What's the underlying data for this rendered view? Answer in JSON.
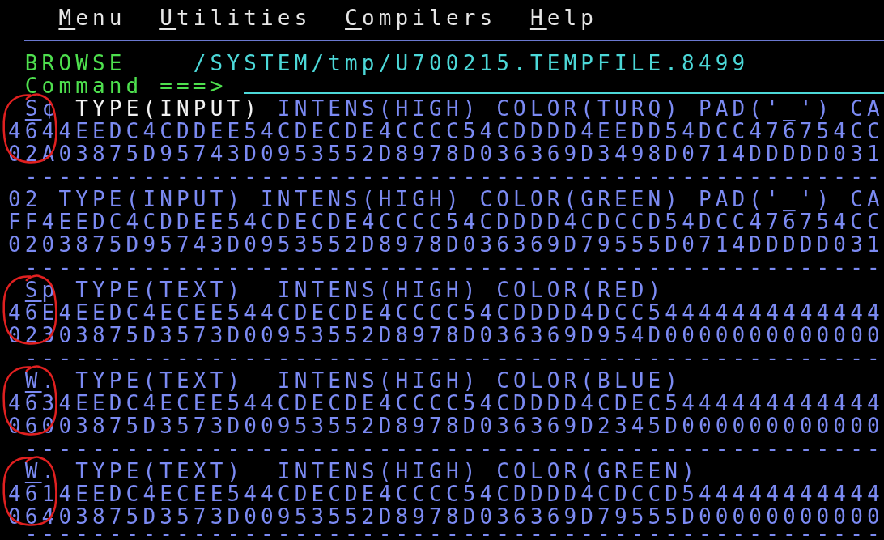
{
  "menu_bar": {
    "items": [
      {
        "mnemonic": "M",
        "rest": "enu"
      },
      {
        "mnemonic": "U",
        "rest": "tilities"
      },
      {
        "mnemonic": "C",
        "rest": "ompilers"
      },
      {
        "mnemonic": "H",
        "rest": "elp"
      }
    ]
  },
  "browse": {
    "mode": "BROWSE",
    "path": "/SYSTEM/tmp/U700215.TEMPFILE.8499"
  },
  "command": {
    "label": "Command ===>"
  },
  "records": [
    {
      "circled": true,
      "indented": true,
      "key": "S¢",
      "key_underlined": true,
      "type": "TYPE(INPUT)",
      "type_highlighted": true,
      "attributes": "INTENS(HIGH) COLOR(TURQ) PAD('_') CA",
      "zone_hex": "4644EEDC4CDDEE54CDECDE4CCCC54CDDDD4EEDD54DCC476754CC",
      "numeric_hex": "02A03875D95743D0953552D8978D036369D3498D0714DDDDD031",
      "separator": "---------------------------------------------------"
    },
    {
      "circled": false,
      "indented": false,
      "key": "02",
      "key_underlined": false,
      "type": "TYPE(INPUT)",
      "type_highlighted": false,
      "attributes": "INTENS(HIGH) COLOR(GREEN) PAD('_') CA",
      "zone_hex": "FF4EEDC4CDDEE54CDECDE4CCCC54CDDDD4CDCCD54DCC476754CC",
      "numeric_hex": "0203875D95743D0953552D8978D036369D79555D0714DDDDD031",
      "separator": "---------------------------------------------------"
    },
    {
      "circled": true,
      "indented": true,
      "key": "Sp",
      "key_underlined": true,
      "type": "TYPE(TEXT) ",
      "type_highlighted": false,
      "attributes": "INTENS(HIGH) COLOR(RED)",
      "zone_hex": "46E4EEDC4ECEE544CDECDE4CCCC54CDDDD4DCC54444444444444",
      "numeric_hex": "02303875D3573D00953552D8978D036369D954D0000000000000",
      "separator": "---------------------------------------------------"
    },
    {
      "circled": true,
      "indented": true,
      "key": "W.",
      "key_underlined": true,
      "type": "TYPE(TEXT) ",
      "type_highlighted": false,
      "attributes": "INTENS(HIGH) COLOR(BLUE)",
      "zone_hex": "4634EEDC4ECEE544CDECDE4CCCC54CDDDD4CDEC5444444444444",
      "numeric_hex": "06003875D3573D00953552D8978D036369D2345D000000000000",
      "separator": "---------------------------------------------------"
    },
    {
      "circled": true,
      "indented": true,
      "key": "W.",
      "key_underlined": true,
      "type": "TYPE(TEXT) ",
      "type_highlighted": false,
      "attributes": "INTENS(HIGH) COLOR(GREEN)",
      "zone_hex": "4614EEDC4ECEE544CDECDE4CCCC54CDDDD4CDCCD544444444444",
      "numeric_hex": "06403875D3573D00953552D8978D036369D79555D00000000000",
      "separator": "---------------------------------------------------"
    }
  ]
}
